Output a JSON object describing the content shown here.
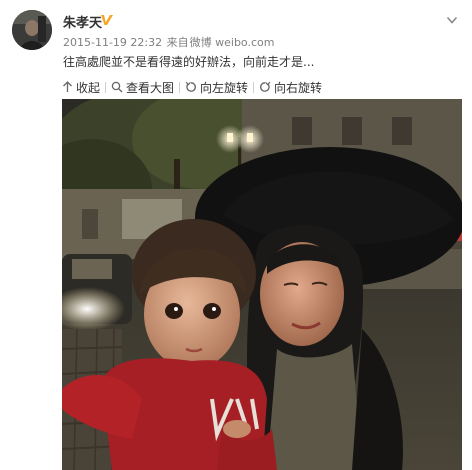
{
  "post": {
    "author": "朱孝天",
    "timestamp": "2015-11-19 22:32",
    "source_prefix": "来自",
    "source": "微博 weibo.com",
    "text": "往高處爬並不是看得遠的好辦法，向前走才是..."
  },
  "toolbar": {
    "collapse_label": "收起",
    "view_large_label": "查看大图",
    "rotate_left_label": "向左旋转",
    "rotate_right_label": "向右旋转"
  },
  "icons": {
    "verified": "verified-badge-icon",
    "dropdown": "chevron-down-icon",
    "collapse": "arrow-up-icon",
    "view_large": "magnifier-icon",
    "rotate_left": "rotate-left-icon",
    "rotate_right": "rotate-right-icon"
  },
  "colors": {
    "verified_badge": "#f5a623",
    "meta_text": "#808080",
    "body_text": "#333333"
  }
}
